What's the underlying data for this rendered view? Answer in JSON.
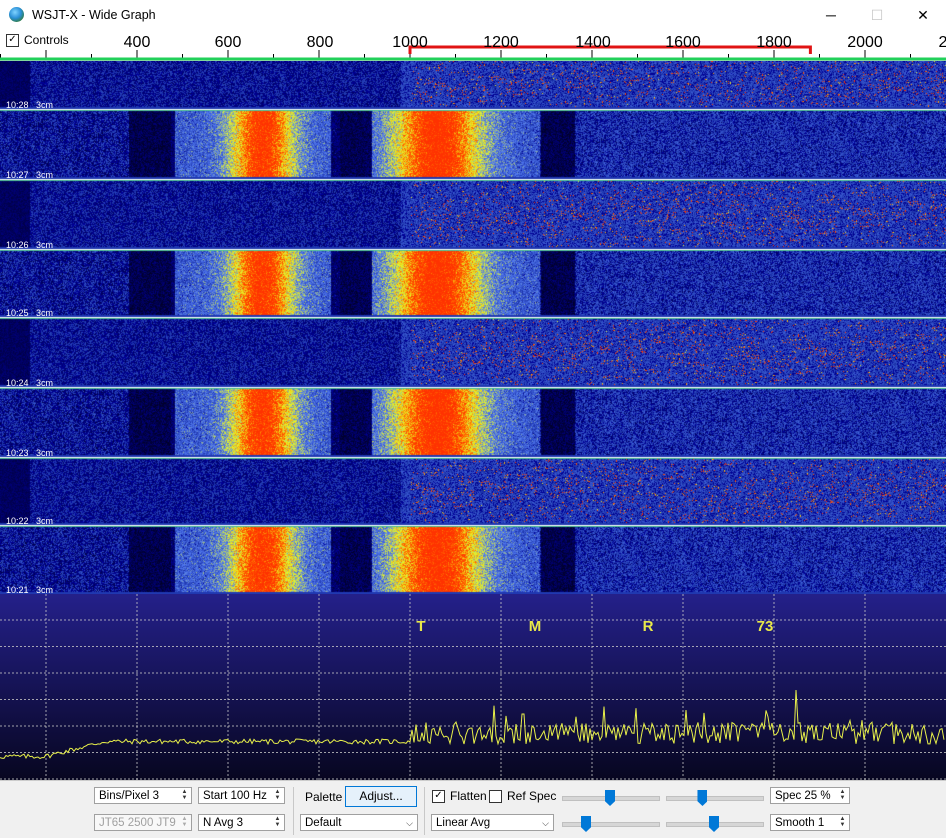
{
  "window": {
    "title": "WSJT-X - Wide Graph",
    "minimize_glyph": "─",
    "maximize_glyph": "☐",
    "close_glyph": "✕"
  },
  "ruler": {
    "controls_label": "Controls",
    "controls_checked": true,
    "labels": [
      "400",
      "600",
      "800",
      "1000",
      "1200",
      "1400",
      "1600",
      "1800",
      "2000",
      "2"
    ]
  },
  "waterfall": {
    "rows": [
      {
        "time": "10:28",
        "band": "3cm",
        "pattern": "signals"
      },
      {
        "time": "10:27",
        "band": "3cm",
        "pattern": "tones"
      },
      {
        "time": "10:26",
        "band": "3cm",
        "pattern": "signals"
      },
      {
        "time": "10:25",
        "band": "3cm",
        "pattern": "tones"
      },
      {
        "time": "10:24",
        "band": "3cm",
        "pattern": "signals"
      },
      {
        "time": "10:23",
        "band": "3cm",
        "pattern": "tones"
      },
      {
        "time": "10:22",
        "band": "3cm",
        "pattern": "signals"
      },
      {
        "time": "10:21",
        "band": "3cm",
        "pattern": "tones"
      }
    ]
  },
  "spectrum": {
    "markers": [
      "T",
      "M",
      "R",
      "73"
    ],
    "marker_color": "#e8e84a"
  },
  "controls": {
    "bins_per_pixel": "Bins/Pixel  3",
    "start": "Start 100 Hz",
    "jt_modes": "JT65  2500  JT9",
    "n_avg": "N Avg 3",
    "palette_label": "Palette",
    "adjust_button": "Adjust...",
    "palette_value": "Default",
    "flatten_label": "Flatten",
    "flatten_checked": true,
    "ref_spec_label": "Ref Spec",
    "ref_spec_checked": false,
    "avg_mode": "Linear Avg",
    "spec": "Spec 25 %",
    "smooth": "Smooth  1",
    "slider_levels": [
      0.5,
      0.38,
      0.25,
      0.5
    ]
  },
  "colors": {
    "accent": "#0078d7",
    "waterfall_bg": "#0d1a6e",
    "spectrum_bg": "#1e1a78",
    "trace": "#e8f04a",
    "grid_green": "#22d05a",
    "cursor_red": "#e01414"
  }
}
